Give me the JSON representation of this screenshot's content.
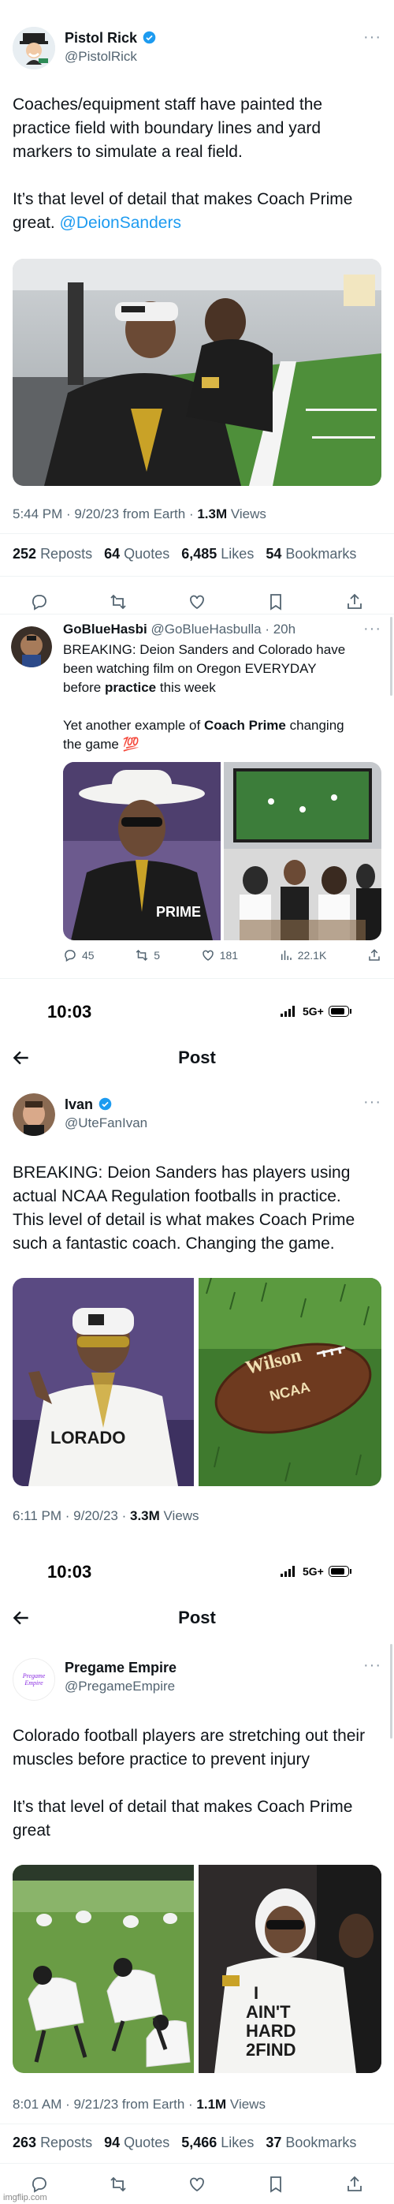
{
  "tweet1": {
    "name": "Pistol Rick",
    "handle": "@PistolRick",
    "text_line1": "Coaches/equipment staff have painted the",
    "text_line2": "practice field with boundary lines and yard",
    "text_line3": "markers to simulate a real field.",
    "text_line4": "It’s that level of detail that makes Coach Prime",
    "text_line5_plain": "great. ",
    "text_line5_mention": "@DeionSanders",
    "time": "5:44 PM · 9/20/23 from Earth · ",
    "views_count": "1.3M",
    "views_label": " Views",
    "reposts": "252",
    "reposts_label": "Reposts",
    "quotes": "64",
    "quotes_label": "Quotes",
    "likes": "6,485",
    "likes_label": "Likes",
    "bookmarks": "54",
    "bookmarks_label": "Bookmarks"
  },
  "tweet2": {
    "name": "GoBlueHasbi",
    "handle_time": "@GoBlueHasbulla · 20h",
    "line1": "BREAKING: Deion Sanders and Colorado have",
    "line2": "been watching film on Oregon EVERYDAY",
    "line3_pre": "before ",
    "line3_bold": "practice",
    "line3_post": " this week",
    "line4_pre": "Yet another example of ",
    "line4_bold": "Coach Prime",
    "line4_post": " changing",
    "line5": "the game 💯",
    "replies": "45",
    "retweets": "5",
    "likes": "181",
    "views": "22.1K"
  },
  "screen2": {
    "status_time": "10:03",
    "network": "5G+",
    "title": "Post"
  },
  "tweet3": {
    "name": "Ivan",
    "handle": "@UteFanIvan",
    "line1": "BREAKING: Deion Sanders has players using",
    "line2": "actual NCAA Regulation footballs in practice.",
    "line3": "This level of detail is what makes Coach Prime",
    "line4": "such a fantastic coach. Changing the game.",
    "time": "6:11 PM · 9/20/23 · ",
    "views_count": "3.3M",
    "views_label": " Views"
  },
  "screen3": {
    "status_time": "10:03",
    "network": "5G+",
    "title": "Post"
  },
  "tweet4": {
    "name": "Pregame Empire",
    "handle": "@PregameEmpire",
    "avatar_text": "Pregame Empire",
    "line1": "Colorado football players are stretching out their",
    "line2": "muscles before practice to prevent injury",
    "line3": "It’s that level of detail that makes Coach Prime",
    "line4": "great",
    "time": "8:01 AM · 9/21/23 from Earth · ",
    "views_count": "1.1M",
    "views_label": " Views",
    "reposts": "263",
    "reposts_label": "Reposts",
    "quotes": "94",
    "quotes_label": "Quotes",
    "likes": "5,466",
    "likes_label": "Likes",
    "bookmarks": "37",
    "bookmarks_label": "Bookmarks"
  },
  "watermark": "imgflip.com",
  "colors": {
    "blue": "#1d9bf0",
    "gray": "#536471",
    "text": "#0f1419"
  }
}
